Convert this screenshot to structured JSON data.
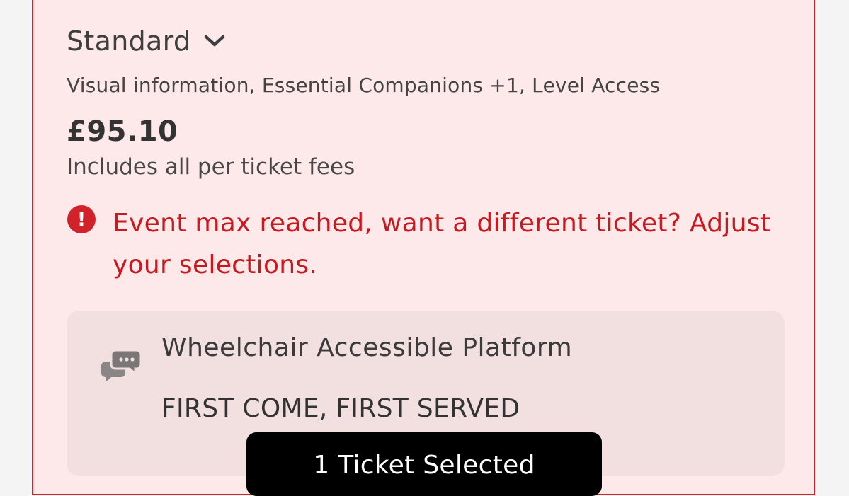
{
  "ticket": {
    "type_selected": "Standard",
    "access_features": "Visual information, Essential Companions +1, Level Access",
    "price": "£95.10",
    "fees_note": "Includes all per ticket fees",
    "error_message": "Event max reached, want a different ticket? Adjust your selections."
  },
  "info_panel": {
    "title": "Wheelchair Accessible Platform",
    "subtitle": "FIRST COME, FIRST SERVED"
  },
  "footer": {
    "selected_label": "1 Ticket Selected"
  },
  "colors": {
    "accent_red": "#d0222a",
    "card_bg": "#fde9ea",
    "panel_bg": "#f2e0e1"
  },
  "icons": [
    "chevron-down-icon",
    "error-icon",
    "chat-bubbles-icon"
  ]
}
